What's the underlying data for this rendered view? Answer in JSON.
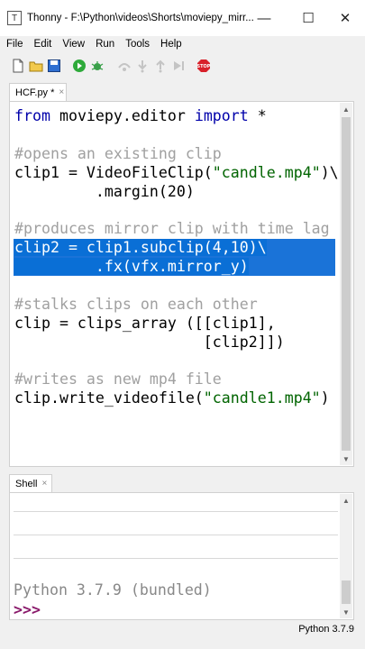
{
  "window": {
    "title": "Thonny  -  F:\\Python\\videos\\Shorts\\moviepy_mirr...",
    "minimize": "—",
    "maximize": "☐",
    "close": "✕"
  },
  "menu": [
    "File",
    "Edit",
    "View",
    "Run",
    "Tools",
    "Help"
  ],
  "toolbar": {
    "icons": [
      "new-file-icon",
      "open-file-icon",
      "save-icon",
      "run-icon",
      "debug-icon",
      "step-over-icon",
      "step-into-icon",
      "step-out-icon",
      "resume-icon",
      "stop-icon"
    ],
    "stop_label": "STOP"
  },
  "editor": {
    "tab_label": "HCF.py *",
    "tab_close": "×",
    "lines": [
      {
        "parts": [
          {
            "t": "from",
            "c": "kw"
          },
          {
            "t": " moviepy.editor ",
            "c": ""
          },
          {
            "t": "import",
            "c": "kw"
          },
          {
            "t": " *",
            "c": ""
          }
        ]
      },
      {
        "parts": []
      },
      {
        "parts": [
          {
            "t": "#opens an existing clip",
            "c": "cm"
          }
        ]
      },
      {
        "parts": [
          {
            "t": "clip1 = VideoFileClip(",
            "c": ""
          },
          {
            "t": "\"candle.mp4\"",
            "c": "st"
          },
          {
            "t": ")\\",
            "c": ""
          }
        ]
      },
      {
        "parts": [
          {
            "t": "         .margin(20)",
            "c": ""
          }
        ]
      },
      {
        "parts": []
      },
      {
        "parts": [
          {
            "t": "#produces mirror clip with time lag",
            "c": "cm"
          }
        ]
      },
      {
        "parts": [
          {
            "t": "clip2 = clip1.subclip(4,10)\\",
            "c": "sel"
          }
        ]
      },
      {
        "parts": [
          {
            "t": "         .fx(vfx.mirror_y)",
            "c": "sel"
          }
        ]
      },
      {
        "parts": []
      },
      {
        "parts": [
          {
            "t": "#stalks clips on each other",
            "c": "cm"
          }
        ]
      },
      {
        "parts": [
          {
            "t": "clip = clips_array ([[clip1],",
            "c": ""
          }
        ]
      },
      {
        "parts": [
          {
            "t": "                     [clip2]])",
            "c": ""
          }
        ]
      },
      {
        "parts": []
      },
      {
        "parts": [
          {
            "t": "#writes as new mp4 file",
            "c": "cm"
          }
        ]
      },
      {
        "parts": [
          {
            "t": "clip.write_videofile(",
            "c": ""
          },
          {
            "t": "\"candle1.mp4\"",
            "c": "st"
          },
          {
            "t": ")",
            "c": ""
          }
        ]
      }
    ]
  },
  "shell": {
    "tab_label": "Shell",
    "tab_close": "×",
    "banner": "Python 3.7.9 (bundled)",
    "prompt": ">>>"
  },
  "status": {
    "interpreter": "Python 3.7.9"
  },
  "colors": {
    "keyword": "#0000aa",
    "comment": "#a0a0a0",
    "string": "#006400",
    "selection": "#1a73d8"
  }
}
